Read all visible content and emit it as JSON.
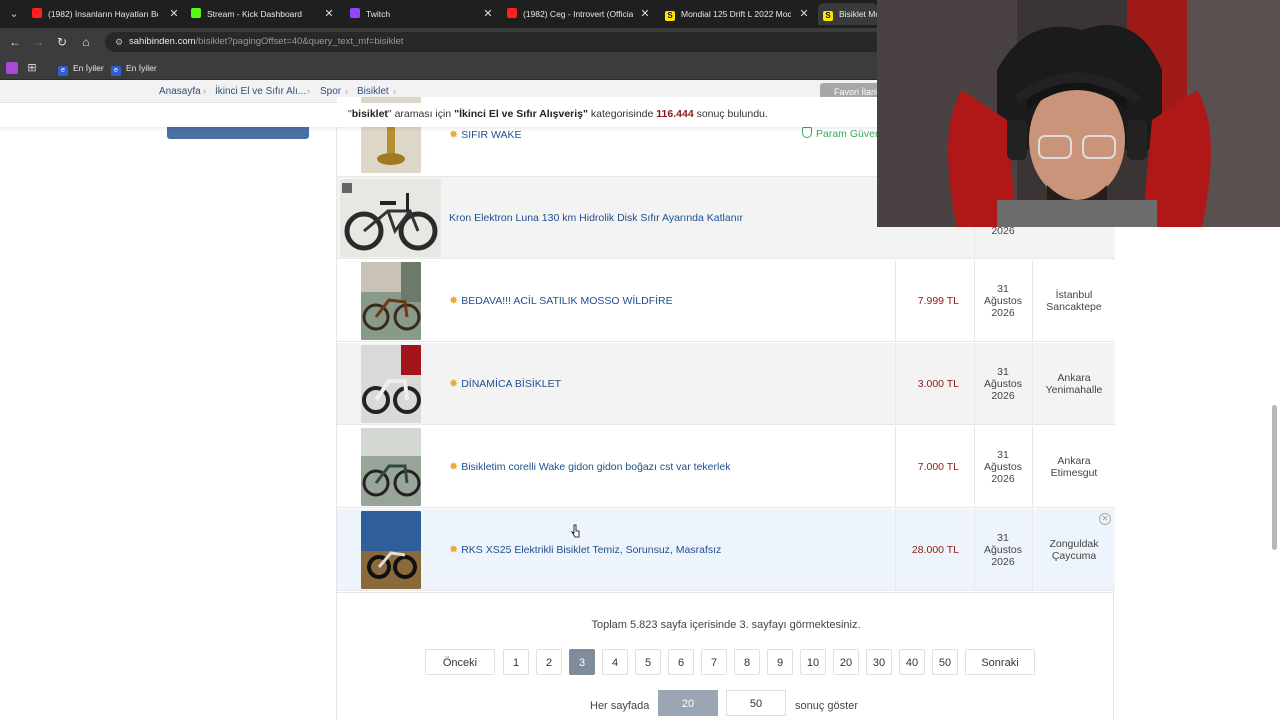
{
  "tabs": [
    {
      "title": "(1982) İnsanların Hayatları Boyu",
      "icon": "youtube-icon",
      "active": false
    },
    {
      "title": "Stream - Kick Dashboard",
      "icon": "kick-icon",
      "active": false
    },
    {
      "title": "Twitch",
      "icon": "twitch-icon",
      "active": false
    },
    {
      "title": "(1982) Ceg - Introvert (Official",
      "icon": "youtube-icon",
      "active": false
    },
    {
      "title": "Mondial 125 Drift L 2022 Mode",
      "icon": "sahibinden-icon",
      "active": false
    },
    {
      "title": "Bisiklet Mo",
      "icon": "sahibinden-icon",
      "active": true
    }
  ],
  "address": {
    "host": "sahibinden.com",
    "path": "/bisiklet?pagingOffset=40&query_text_mf=bisiklet"
  },
  "bookmarks": [
    {
      "label": "En İyiler"
    },
    {
      "label": "En İyiler"
    }
  ],
  "breadcrumb": [
    "Anasayfa",
    "İkinci El ve Sıfır Alı...",
    "Spor",
    "Bisiklet"
  ],
  "favorite_searches": "Favori İlanl",
  "result": {
    "quote_open": "\"",
    "query": "bisiklet",
    "mid1": "\" araması için ",
    "category": "\"İkinci El ve Sıfır Alışveriş\"",
    "mid2": " kategorisinde ",
    "count": "116.444",
    "end": " sonuç bulundu."
  },
  "listings": [
    {
      "title": "SIFIR WAKE",
      "price": "",
      "date": [],
      "location": [],
      "starred": true,
      "badge": "Param Güven"
    },
    {
      "title": "Kron Elektron Luna 130 km Hidrolik Disk Sıfır Ayarında Katlanır",
      "price": "",
      "date": [
        "",
        "",
        "2026"
      ],
      "location": [],
      "starred": false
    },
    {
      "title": "BEDAVA!!! ACİL SATILIK MOSSO WİLDFİRE",
      "price": "7.999 TL",
      "date": [
        "31",
        "Ağustos",
        "2026"
      ],
      "location": [
        "İstanbul",
        "Sancaktepe"
      ],
      "starred": true
    },
    {
      "title": "DİNAMİCA BİSİKLET",
      "price": "3.000 TL",
      "date": [
        "31",
        "Ağustos",
        "2026"
      ],
      "location": [
        "Ankara",
        "Yenimahalle"
      ],
      "starred": true
    },
    {
      "title": "Bisikletim corelli Wake gidon gidon boğazı cst var tekerlek",
      "price": "7.000 TL",
      "date": [
        "31",
        "Ağustos",
        "2026"
      ],
      "location": [
        "Ankara",
        "Etimesgut"
      ],
      "starred": true
    },
    {
      "title": "RKS XS25 Elektrikli Bisiklet Temiz, Sorunsuz, Masrafsız",
      "price": "28.000 TL",
      "date": [
        "31",
        "Ağustos",
        "2026"
      ],
      "location": [
        "Zonguldak",
        "Çaycuma"
      ],
      "starred": true
    }
  ],
  "pagination": {
    "summary": "Toplam 5.823 sayfa içerisinde 3. sayfayı görmektesiniz.",
    "prev": "Önceki",
    "next": "Sonraki",
    "pages": [
      "1",
      "2",
      "3",
      "4",
      "5",
      "6",
      "7",
      "8",
      "9",
      "10",
      "20",
      "30",
      "40",
      "50"
    ],
    "current": "3"
  },
  "per_page": {
    "label": "Her sayfada",
    "options": [
      "20",
      "50"
    ],
    "selected": "20",
    "suffix": "sonuç göster"
  },
  "colors": {
    "price": "#8b1a1a",
    "link": "#1f4f8f",
    "param_guven": "#3aa860",
    "active_page": "#7f8c9a"
  }
}
